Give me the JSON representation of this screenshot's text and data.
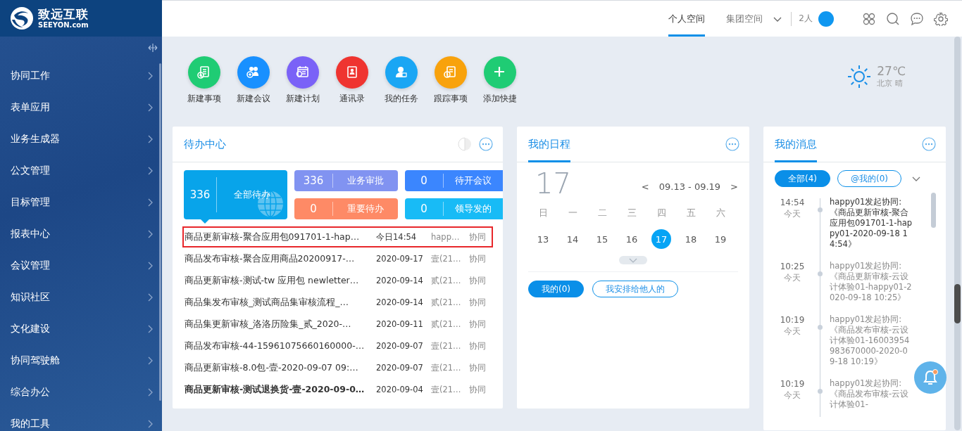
{
  "logo": {
    "name": "致远互联",
    "domain": "SEEYON.com"
  },
  "sidebar": {
    "items": [
      {
        "label": "协同工作"
      },
      {
        "label": "表单应用"
      },
      {
        "label": "业务生成器"
      },
      {
        "label": "公文管理"
      },
      {
        "label": "目标管理"
      },
      {
        "label": "报表中心"
      },
      {
        "label": "会议管理"
      },
      {
        "label": "知识社区"
      },
      {
        "label": "文化建设"
      },
      {
        "label": "协同驾驶舱"
      },
      {
        "label": "综合办公"
      },
      {
        "label": "我的工具"
      }
    ]
  },
  "header": {
    "tabs": [
      {
        "label": "个人空间",
        "selected": true
      },
      {
        "label": "集团空间",
        "selected": false
      }
    ],
    "online_count": "2人"
  },
  "shortcuts": [
    {
      "label": "新建事项",
      "color": "#1fcc74"
    },
    {
      "label": "新建会议",
      "color": "#1890ff"
    },
    {
      "label": "新建计划",
      "color": "#7a62f7"
    },
    {
      "label": "通讯录",
      "color": "#ef3430"
    },
    {
      "label": "我的任务",
      "color": "#1aa6f4"
    },
    {
      "label": "跟踪事项",
      "color": "#f8a20c"
    },
    {
      "label": "添加快捷",
      "color": "#1fcc74"
    }
  ],
  "weather": {
    "temperature": "27℃",
    "location": "北京 晴"
  },
  "todo": {
    "title": "待办中心",
    "tiles": [
      {
        "count": "336",
        "label": "全部待办",
        "color": "#08a4ea",
        "selected": true
      },
      {
        "count": "336",
        "label": "业务审批",
        "color": "#8193f1",
        "selected": false
      },
      {
        "count": "0",
        "label": "待开会议",
        "color": "#3b86fe",
        "selected": false
      },
      {
        "count": "0",
        "label": "重要待办",
        "color": "#fe8a66",
        "selected": false
      },
      {
        "count": "0",
        "label": "领导发的",
        "color": "#18bbf6",
        "selected": false
      }
    ],
    "rows": [
      {
        "title": "商品更新审核-聚合应用包091701-1-hap…",
        "date": "今日14:54",
        "sender": "happ…",
        "type": "协同",
        "selected": true,
        "unread": false
      },
      {
        "title": "商品发布审核-聚合应用商品20200917-…",
        "date": "2020-09-17",
        "sender": "壹(21…",
        "type": "协同",
        "selected": false,
        "unread": false
      },
      {
        "title": "商品更新审核-测试-tw 应用包 newletter…",
        "date": "2020-09-14",
        "sender": "贰(21…",
        "type": "协同",
        "selected": false,
        "unread": false
      },
      {
        "title": "商品集发布审核_测试商品集审核流程_…",
        "date": "2020-09-14",
        "sender": "贰(21…",
        "type": "协同",
        "selected": false,
        "unread": false
      },
      {
        "title": "商品集更新审核_洛洛历险集_贰_2020-…",
        "date": "2020-09-11",
        "sender": "贰(21…",
        "type": "协同",
        "selected": false,
        "unread": false
      },
      {
        "title": "商品发布审核-44-15961075660160000-…",
        "date": "2020-09-07",
        "sender": "壹(21…",
        "type": "协同",
        "selected": false,
        "unread": false
      },
      {
        "title": "商品更新审核-8.0包-壹-2020-09-07 09:…",
        "date": "2020-09-07",
        "sender": "壹(21…",
        "type": "协同",
        "selected": false,
        "unread": false
      },
      {
        "title": "商品更新审核-测试退换货-壹-2020-09-0…",
        "date": "2020-09-04",
        "sender": "壹(21…",
        "type": "协同",
        "selected": false,
        "unread": true
      }
    ]
  },
  "schedule": {
    "title": "我的日程",
    "big_date": "17",
    "prev": "<",
    "range": "09.13 - 09.19",
    "next": ">",
    "weekdays": [
      "日",
      "一",
      "二",
      "三",
      "四",
      "五",
      "六"
    ],
    "days": [
      {
        "label": "13",
        "selected": false
      },
      {
        "label": "14",
        "selected": false
      },
      {
        "label": "15",
        "selected": false
      },
      {
        "label": "16",
        "selected": false
      },
      {
        "label": "17",
        "selected": true
      },
      {
        "label": "18",
        "selected": false
      },
      {
        "label": "19",
        "selected": false
      }
    ],
    "filters": [
      {
        "label": "我的(0)",
        "selected": true
      },
      {
        "label": "我安排给他人的",
        "selected": false
      }
    ]
  },
  "messages": {
    "title": "我的消息",
    "filters": [
      {
        "label": "全部(4)",
        "selected": true
      },
      {
        "label": "@我的(0)",
        "selected": false
      }
    ],
    "items": [
      {
        "time": "14:54",
        "day": "今天",
        "text": "happy01发起协同:《商品更新审核-聚合应用包091701-1-happy01-2020-09-18 14:54》",
        "unread": true
      },
      {
        "time": "10:25",
        "day": "今天",
        "text": "happy01发起协同:《商品更新审核-云设计体验01-happy01-2020-09-18 10:25》",
        "unread": false
      },
      {
        "time": "10:19",
        "day": "今天",
        "text": "happy01发起协同:《商品发布审核-云设计体验01-16003954983670000-2020-09-18 10:19》",
        "unread": false
      },
      {
        "time": "10:19",
        "day": "今天",
        "text": "happy01发起协同:《商品发布审核-云设计体验01-",
        "unread": false
      }
    ]
  }
}
